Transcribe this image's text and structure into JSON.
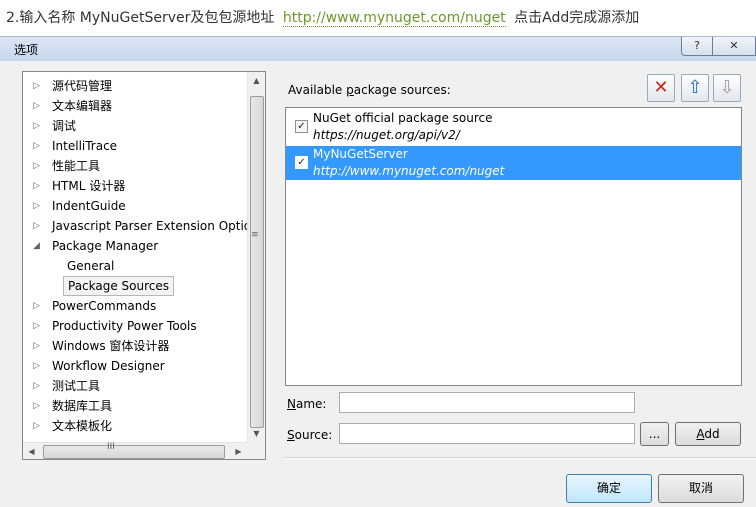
{
  "caption": {
    "prefix": "2.输入名称 MyNuGetServer及包包源地址",
    "url": "http://www.mynuget.com/nuget",
    "suffix": "点击Add完成源添加"
  },
  "window": {
    "title": "选项",
    "help_glyph": "?",
    "close_glyph": "✕"
  },
  "tree": {
    "items": [
      {
        "label": "源代码管理",
        "arrow": "▷"
      },
      {
        "label": "文本编辑器",
        "arrow": "▷"
      },
      {
        "label": "调试",
        "arrow": "▷"
      },
      {
        "label": "IntelliTrace",
        "arrow": "▷"
      },
      {
        "label": "性能工具",
        "arrow": "▷"
      },
      {
        "label": "HTML 设计器",
        "arrow": "▷"
      },
      {
        "label": "IndentGuide",
        "arrow": "▷"
      },
      {
        "label": "Javascript Parser Extension Options",
        "arrow": "▷"
      },
      {
        "label": "Package Manager",
        "arrow": "◢"
      },
      {
        "label": "General",
        "arrow": ""
      },
      {
        "label": "Package Sources",
        "arrow": ""
      },
      {
        "label": "PowerCommands",
        "arrow": "▷"
      },
      {
        "label": "Productivity Power Tools",
        "arrow": "▷"
      },
      {
        "label": "Windows 窗体设计器",
        "arrow": "▷"
      },
      {
        "label": "Workflow Designer",
        "arrow": "▷"
      },
      {
        "label": "测试工具",
        "arrow": "▷"
      },
      {
        "label": "数据库工具",
        "arrow": "▷"
      },
      {
        "label": "文本模板化",
        "arrow": "▷"
      }
    ],
    "selected": "Package Sources",
    "scroll_up": "▲",
    "scroll_down": "▼",
    "scroll_left": "◀",
    "scroll_right": "▶",
    "grip_v": "≡",
    "grip_h": "III"
  },
  "sources": {
    "label_prefix": "Available ",
    "label_access": "p",
    "label_suffix": "ackage sources:",
    "remove_glyph": "✕",
    "up_glyph": "⇧",
    "down_glyph": "⇩",
    "items": [
      {
        "name": "NuGet official package source",
        "url": "https://nuget.org/api/v2/",
        "checked": true,
        "check_glyph": "✓"
      },
      {
        "name": "MyNuGetServer",
        "url": "http://www.mynuget.com/nuget",
        "checked": true,
        "check_glyph": "✓"
      }
    ],
    "selected": "MyNuGetServer"
  },
  "form": {
    "name_access": "N",
    "name_rest": "ame:",
    "name_value": "",
    "source_access": "S",
    "source_rest": "ource:",
    "source_value": "",
    "browse_label": "...",
    "add_access": "A",
    "add_rest": "dd"
  },
  "footer": {
    "ok_label": "确定",
    "cancel_label": "取消"
  },
  "colors": {
    "selection": "#3399ff",
    "url_green": "#6a9a2a",
    "remove_red": "#d8231a",
    "up_blue": "#1f68c7"
  }
}
